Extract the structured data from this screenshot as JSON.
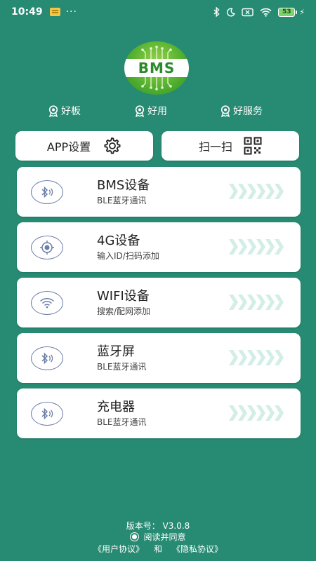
{
  "status_bar": {
    "time": "10:49",
    "more": "···",
    "battery_level": "53",
    "icons": [
      "notification-app-icon",
      "bluetooth-icon",
      "moon-icon",
      "sim-off-icon",
      "wifi-icon",
      "battery-icon",
      "charging-icon"
    ]
  },
  "logo": {
    "text": "BMS"
  },
  "slogans": [
    "好板",
    "好用",
    "好服务"
  ],
  "buttons": {
    "app_settings": "APP设置",
    "scan": "扫一扫"
  },
  "devices": [
    {
      "title": "BMS设备",
      "subtitle": "BLE蓝牙通讯",
      "icon": "bluetooth-icon"
    },
    {
      "title": "4G设备",
      "subtitle": "输入ID/扫码添加",
      "icon": "target-icon"
    },
    {
      "title": "WIFI设备",
      "subtitle": "搜索/配网添加",
      "icon": "wifi-icon"
    },
    {
      "title": "蓝牙屏",
      "subtitle": "BLE蓝牙通讯",
      "icon": "bluetooth-icon"
    },
    {
      "title": "充电器",
      "subtitle": "BLE蓝牙通讯",
      "icon": "bluetooth-icon"
    }
  ],
  "footer": {
    "version": "版本号： V3.0.8",
    "agree_label": "阅读并同意",
    "user_agreement": "《用户协议》",
    "and": "和",
    "privacy_policy": "《隐私协议》"
  },
  "colors": {
    "background": "#278a72",
    "card": "#ffffff",
    "icon_stroke": "#6b7fa8",
    "chevron": "#d3eee6",
    "logo_green": "#4fae2e"
  }
}
